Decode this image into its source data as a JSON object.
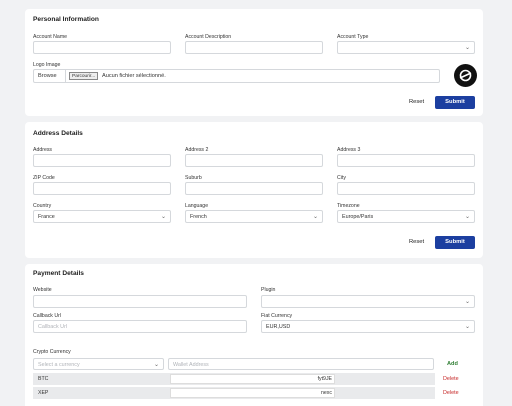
{
  "personal": {
    "title": "Personal Information",
    "account_name_label": "Account Name",
    "account_name_value": "",
    "account_description_label": "Account Description",
    "account_description_value": "",
    "account_type_label": "Account Type",
    "account_type_value": "",
    "logo_label": "Logo Image",
    "browse_label": "Browse",
    "file_button_label": "Parcourir...",
    "file_status": "Aucun fichier sélectionné.",
    "reset_label": "Reset",
    "submit_label": "Submit"
  },
  "address": {
    "title": "Address Details",
    "address_label": "Address",
    "address2_label": "Address 2",
    "address3_label": "Address 3",
    "zip_label": "ZIP Code",
    "suburb_label": "Suburb",
    "city_label": "City",
    "country_label": "Country",
    "country_value": "France",
    "language_label": "Language",
    "language_value": "French",
    "timezone_label": "Timezone",
    "timezone_value": "Europe/Paris",
    "reset_label": "Reset",
    "submit_label": "Submit"
  },
  "payment": {
    "title": "Payment Details",
    "website_label": "Website",
    "plugin_label": "Plugin",
    "callback_label": "Callback Url",
    "callback_placeholder": "Callback Url",
    "fiat_label": "Fiat Currency",
    "fiat_value": "EUR,USD",
    "crypto_label": "Crypto Currency",
    "select_currency_placeholder": "Select a currency",
    "wallet_placeholder": "Wallet Address",
    "add_label": "Add",
    "rows": [
      {
        "currency": "BTC",
        "wallet": "fyt9JE",
        "delete_label": "Delete"
      },
      {
        "currency": "XEP",
        "wallet": "nexc",
        "delete_label": "Delete"
      }
    ]
  },
  "colors": {
    "accent": "#1c3fa0",
    "delete": "#c62828",
    "add": "#2e7d32"
  }
}
